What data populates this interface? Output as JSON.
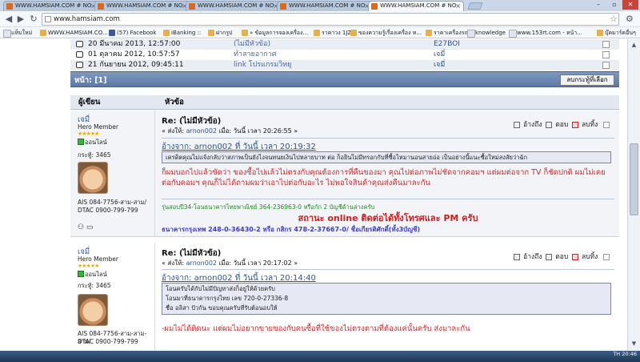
{
  "browser": {
    "tabs": [
      {
        "title": "WWW.HAMSIAM.COM # NO",
        "active": false
      },
      {
        "title": "WWW.HAMSIAM.COM # NO",
        "active": false
      },
      {
        "title": "WWW.HAMSIAM.COM # NO",
        "active": false
      },
      {
        "title": "WWW.HAMSIAM.COM # NO",
        "active": false
      },
      {
        "title": "WWW.HAMSIAM.COM # NO",
        "active": true
      }
    ],
    "url": "www.hamsiam.com",
    "bookmarks": [
      "แท็บใหม่",
      "WWW.HAMSIAM.CO...",
      "(57) Facebook",
      "iBanking ::",
      "ฝากรูป",
      "» ข้อมูลการจองเครื่อง...",
      "ราคาวง 1JZ",
      "ของความรู้เรื่องเครื่อง ท...",
      "ราคาเครื่องรถยุ่น",
      "knowledge",
      "www.153rt.com - หน้า...",
      "บุ๊คมาร์คอื่นๆ"
    ]
  },
  "messages": [
    {
      "date": "20 มีนาคม 2013, 12:57:00",
      "subject": "(ไม่มีหัวข้อ)",
      "from": "E27BOI"
    },
    {
      "date": "01 ตุลาคม 2012, 10:57:57",
      "subject": "ทำสายอากาศ",
      "from": "เจมี่"
    },
    {
      "date": "21 กันยายน 2012, 09:45:11",
      "subject": "link โปรแกรมวิทยุ",
      "from": "เจมี่"
    }
  ],
  "pager": {
    "label": "หน้า: [1]",
    "delete_selected": "ลบกระทู้ที่เลือก"
  },
  "columns": {
    "author": "ผู้เขียน",
    "topic": "หัวข้อ"
  },
  "posts": [
    {
      "author": "เจมี่",
      "rank": "Hero Member",
      "stars": "★★★★★",
      "status": "ออนไลน์",
      "post_count": "กระทู้: 3465",
      "contact_1": "AIS 084-7756-สาม-สาม/",
      "contact_2": "DTAC 0900-799-799",
      "title": "Re: (ไม่มีหัวข้อ)",
      "meta_sent_label": "« ส่งให้: ",
      "meta_sent_name": "arnon002",
      "meta_when": " เมื่อ: วันนี้ เวลา 20:26:55 »",
      "quote_head": "อ้างจาก: arnon002 ที่ วันนี้ เวลา 20:19:32",
      "quote_lines": [
        "เครดิตคุณไม่แจ้งกลับว่าสภาพเป็นยังไงจนทนยเงินไปหลายบาท ต่อ ก็อยินไม่มีทรอกกับที่ซื้อไหมานอนสายอ่อ เป็นอย่างนี้แนะซื้อใหม่สงสัยว่าฉัก"
      ],
      "body": "ก็ผมบอกไปแล้วขัดว่า ของซื้อไปแล้วไม่ตรงกับคุณต้องการที่คืนของมา คุณไปต่อภาพไม่ชัดจากคอมฯ แต่ผมต่อจาก TV ก็ชัดปกติ ผมไม่เคยต่อกับคอมฯ คุณก็ไม่ได้ถามผมว่าเอาไปต่อกับอะไร ไม่พอใจสินค้าคุณส่งคืนมาละกัน",
      "sig_bank_1": "รุ่นสอบปี34-โอนธนาคารไทยพาณิชย์ 364-236963-0 หรือกัก 2 บัญชีด้านล่างครับ",
      "sig_status": "สถานะ online ติดต่อได้ทั้งโทรศและ PM ครับ",
      "sig_bank_2": "ธนาคารกรุงเทพ 248-0-36430-2 หรือ กสิกร 478-2-37667-0/ ชื่อเกียรติศักดิ์(ทั้ง3บัญชี)",
      "actions": {
        "quote": "อ้างถึง",
        "reply": "ตอบ",
        "delete": "ลบทิ้ง"
      }
    },
    {
      "author": "เจมี่",
      "rank": "Hero Member",
      "stars": "★★★★★",
      "status": "ออนไลน์",
      "post_count": "กระทู้: 3465",
      "contact_1": "AIS 084-7756-สาม-สาม-สาม/",
      "contact_2": "DTAC 0900-799-799",
      "title": "Re: (ไม่มีหัวข้อ)",
      "meta_sent_label": "« ส่งให้: ",
      "meta_sent_name": "arnon002",
      "meta_when": " เมื่อ: วันนี้ เวลา 20:17:02 »",
      "quote_head": "อ้างจาก: arnon002 ที่ วันนี้ เวลา 20:14:40",
      "quote_lines": [
        "โอนครับได้กับไม่มีปัญหาส่งก็อยู่ให้ด้วยครับ",
        "โอนมาที่ธนาคารกรุงไทย เลข 720-0-27336-8",
        "ชื่อ อลิสา ปัวกัน ขอบคุณครับที่รับต้อนอบให้"
      ],
      "body": "-ผมไม่ได้ติดนะ แต่ผมไม่อยากขายของกับคนซื้อที่ใช้ของไม่ตรงตามที่ต้องแค่นั้นครับ ส่งมาละกัน",
      "actions": {
        "quote": "อ้างถึง",
        "reply": "ตอบ",
        "delete": "ลบทิ้ง"
      }
    }
  ],
  "taskbar": {
    "time": "20:46",
    "lang": "TH"
  }
}
